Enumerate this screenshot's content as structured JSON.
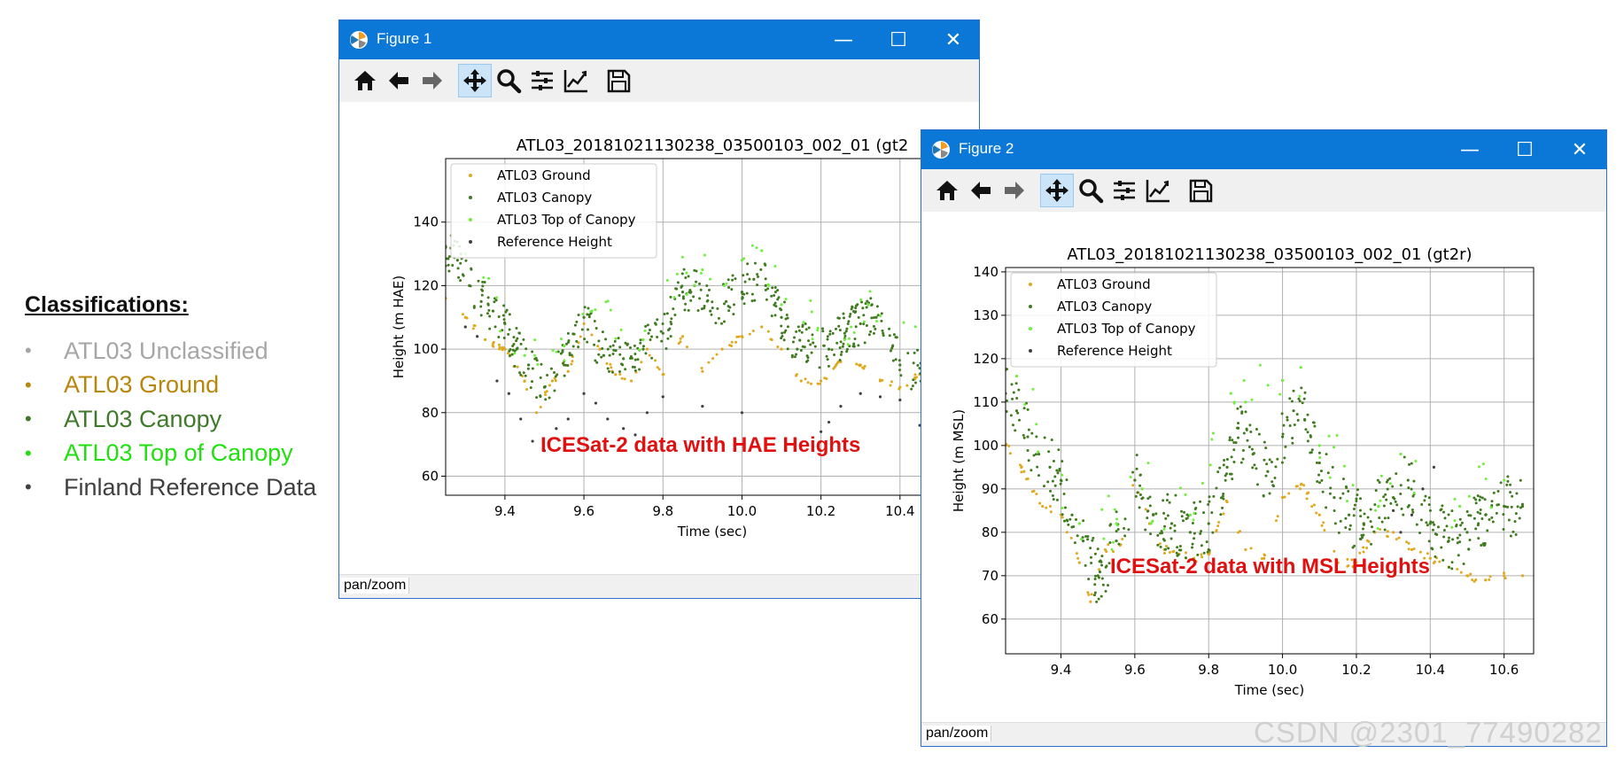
{
  "legend_panel": {
    "title": "Classifications:",
    "items": [
      {
        "label": "ATL03 Unclassified",
        "color": "#a6a6a6"
      },
      {
        "label": "ATL03 Ground",
        "color": "#b8860b"
      },
      {
        "label": "ATL03 Canopy",
        "color": "#3f7a2a"
      },
      {
        "label": "ATL03 Top of Canopy",
        "color": "#22e010"
      },
      {
        "label": "Finland Reference Data",
        "color": "#404040"
      }
    ]
  },
  "windows": [
    {
      "title": "Figure 1",
      "status": "pan/zoom",
      "annotation": "ICESat-2 data with HAE Heights",
      "tools": [
        "home-icon",
        "back-arrow-icon",
        "forward-arrow-icon",
        "pan-icon",
        "zoom-icon",
        "subplots-icon",
        "edit-axis-icon",
        "save-icon"
      ]
    },
    {
      "title": "Figure 2",
      "status": "pan/zoom",
      "annotation": "ICESat-2 data with MSL Heights",
      "tools": [
        "home-icon",
        "back-arrow-icon",
        "forward-arrow-icon",
        "pan-icon",
        "zoom-icon",
        "subplots-icon",
        "edit-axis-icon",
        "save-icon"
      ]
    }
  ],
  "titlebar_buttons": {
    "minimize": "—",
    "maximize": "☐",
    "close": "✕"
  },
  "watermark": "CSDN @2301_77490282",
  "colors": {
    "titlebar": "#0b78d7",
    "ground": "#e0a81c",
    "canopy": "#3f7a1f",
    "top_of_canopy": "#6cf03a",
    "reference": "#404040",
    "annotation": "#e01010"
  },
  "chart_data": [
    {
      "type": "scatter",
      "title": "ATL03_20181021130238_03500103_002_01 (gt2",
      "xlabel": "Time (sec)",
      "ylabel": "Height (m HAE)",
      "xlim": [
        9.25,
        10.6
      ],
      "ylim": [
        54,
        160
      ],
      "xticks": [
        9.4,
        9.6,
        9.8,
        10.0,
        10.2,
        10.4
      ],
      "yticks": [
        60,
        80,
        100,
        120,
        140
      ],
      "grid": true,
      "legend_position": "top-left",
      "series": [
        {
          "name": "ATL03 Ground",
          "color": "#e0a81c",
          "x": [
            9.25,
            9.3,
            9.35,
            9.4,
            9.45,
            9.48,
            9.52,
            9.56,
            9.6,
            9.64,
            9.68,
            9.72,
            9.76,
            9.8,
            9.85,
            9.9,
            9.95,
            10.0,
            10.05,
            10.1,
            10.15,
            10.2,
            10.25,
            10.3,
            10.35,
            10.4,
            10.45,
            10.5,
            10.55,
            10.6
          ],
          "y": [
            116,
            110,
            103,
            100,
            90,
            80,
            90,
            93,
            108,
            100,
            92,
            90,
            100,
            92,
            104,
            93,
            100,
            104,
            107,
            100,
            90,
            90,
            96,
            95,
            90,
            88,
            92,
            90,
            88,
            89
          ]
        },
        {
          "name": "ATL03 Canopy",
          "color": "#3f7a1f",
          "x": [
            9.25,
            9.28,
            9.31,
            9.34,
            9.37,
            9.4,
            9.43,
            9.46,
            9.5,
            9.55,
            9.6,
            9.65,
            9.7,
            9.75,
            9.8,
            9.85,
            9.88,
            9.92,
            9.96,
            10.0,
            10.03,
            10.06,
            10.1,
            10.14,
            10.18,
            10.22,
            10.26,
            10.3,
            10.34,
            10.4,
            10.45,
            10.5,
            10.55,
            10.6
          ],
          "y": [
            132,
            128,
            120,
            115,
            112,
            108,
            100,
            95,
            88,
            95,
            110,
            98,
            97,
            100,
            105,
            118,
            120,
            112,
            115,
            118,
            122,
            120,
            110,
            100,
            102,
            100,
            105,
            108,
            110,
            95,
            94,
            98,
            104,
            106
          ]
        },
        {
          "name": "ATL03 Top of Canopy",
          "color": "#6cf03a",
          "x": [
            9.3,
            9.45,
            9.55,
            9.62,
            9.75,
            9.86,
            9.9,
            10.0,
            10.05,
            10.1,
            10.26,
            10.32,
            10.48,
            10.56
          ],
          "y": [
            130,
            98,
            101,
            112,
            103,
            124,
            125,
            128,
            131,
            114,
            103,
            114,
            100,
            108
          ]
        },
        {
          "name": "Reference Height",
          "color": "#404040",
          "x": [
            9.3,
            9.33,
            9.38,
            9.41,
            9.44,
            9.47,
            9.5,
            9.53,
            9.56,
            9.6,
            9.63,
            9.66,
            9.7,
            9.73,
            9.76,
            9.8,
            9.9,
            10.0,
            10.2,
            10.22,
            10.25,
            10.3,
            10.35,
            10.4,
            10.45,
            10.5
          ],
          "y": [
            107,
            104,
            90,
            86,
            78,
            71,
            68,
            75,
            78,
            86,
            83,
            78,
            75,
            73,
            80,
            85,
            82,
            80,
            74,
            77,
            82,
            86,
            85,
            84,
            76,
            77
          ]
        }
      ]
    },
    {
      "type": "scatter",
      "title": "ATL03_20181021130238_03500103_002_01 (gt2r)",
      "xlabel": "Time (sec)",
      "ylabel": "Height (m MSL)",
      "xlim": [
        9.25,
        10.68
      ],
      "ylim": [
        52,
        141
      ],
      "xticks": [
        9.4,
        9.6,
        9.8,
        10.0,
        10.2,
        10.4,
        10.6
      ],
      "yticks": [
        60,
        70,
        80,
        90,
        100,
        110,
        120,
        130,
        140
      ],
      "grid": true,
      "legend_position": "top-left",
      "series": [
        {
          "name": "ATL03 Ground",
          "color": "#e0a81c",
          "x": [
            9.25,
            9.3,
            9.35,
            9.4,
            9.45,
            9.48,
            9.52,
            9.56,
            9.6,
            9.64,
            9.68,
            9.72,
            9.76,
            9.8,
            9.85,
            9.9,
            9.95,
            10.0,
            10.05,
            10.1,
            10.15,
            10.2,
            10.25,
            10.3,
            10.35,
            10.4,
            10.45,
            10.5,
            10.55,
            10.6,
            10.65
          ],
          "y": [
            100,
            94,
            86,
            84,
            73,
            64,
            76,
            77,
            92,
            82,
            76,
            75,
            74,
            75,
            87,
            76,
            74,
            88,
            91,
            84,
            73,
            73,
            80,
            80,
            76,
            74,
            72,
            70,
            69,
            70,
            70
          ]
        },
        {
          "name": "ATL03 Canopy",
          "color": "#3f7a1f",
          "x": [
            9.25,
            9.28,
            9.31,
            9.34,
            9.37,
            9.4,
            9.43,
            9.46,
            9.5,
            9.55,
            9.6,
            9.65,
            9.7,
            9.75,
            9.8,
            9.85,
            9.88,
            9.92,
            9.96,
            10.0,
            10.03,
            10.06,
            10.1,
            10.14,
            10.18,
            10.22,
            10.26,
            10.3,
            10.34,
            10.4,
            10.45,
            10.5,
            10.55,
            10.6,
            10.65
          ],
          "y": [
            112,
            108,
            102,
            98,
            95,
            92,
            84,
            78,
            70,
            78,
            92,
            84,
            82,
            80,
            82,
            95,
            104,
            98,
            94,
            102,
            108,
            106,
            96,
            88,
            84,
            82,
            86,
            88,
            92,
            82,
            78,
            80,
            84,
            86,
            86
          ]
        },
        {
          "name": "ATL03 Top of Canopy",
          "color": "#6cf03a",
          "x": [
            9.28,
            9.45,
            9.55,
            9.62,
            9.75,
            9.86,
            9.9,
            10.0,
            10.05,
            10.1,
            10.26,
            10.32,
            10.48,
            10.6
          ],
          "y": [
            116,
            82,
            82,
            90,
            84,
            112,
            110,
            115,
            118,
            100,
            86,
            98,
            86,
            92
          ]
        },
        {
          "name": "Reference Height",
          "color": "#404040",
          "x": [
            10.3,
            10.32,
            10.35,
            10.38,
            10.41
          ],
          "y": [
            85,
            80,
            84,
            90,
            95
          ]
        }
      ]
    }
  ]
}
